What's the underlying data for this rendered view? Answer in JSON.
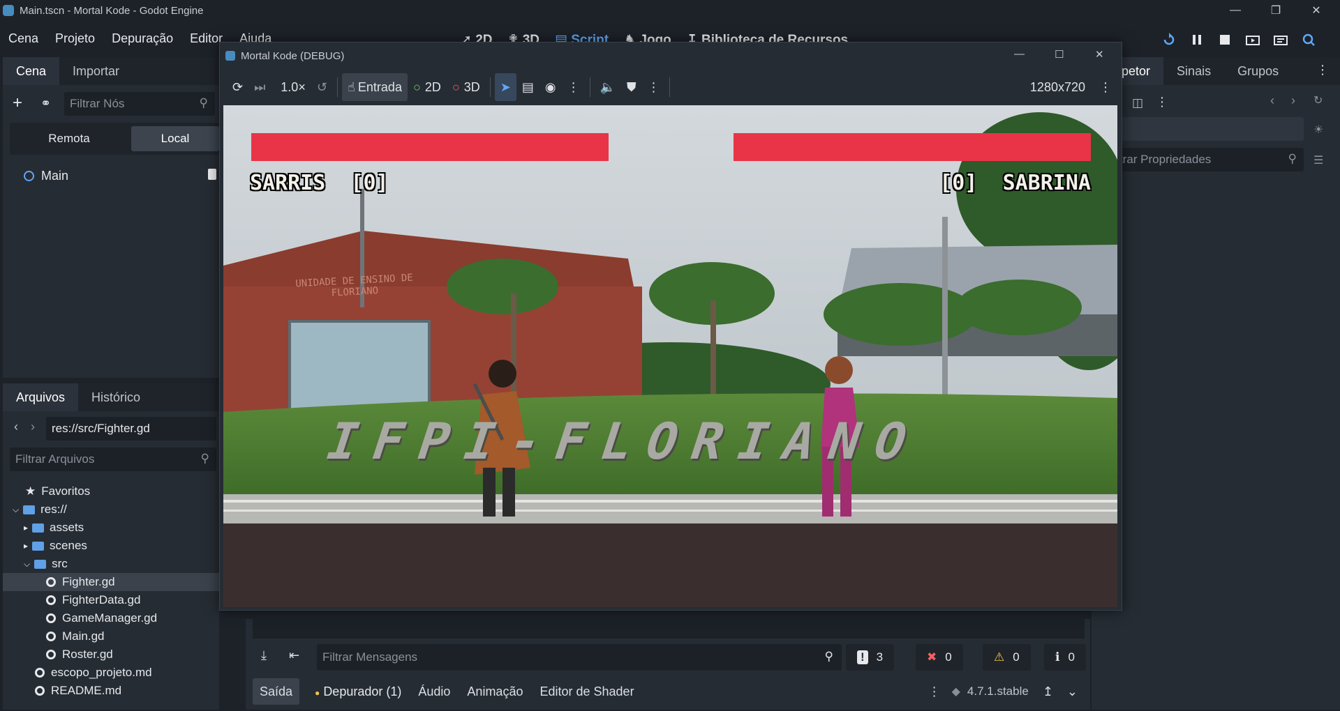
{
  "os": {
    "window_title": "Main.tscn - Mortal Kode - Godot Engine"
  },
  "menu": [
    "Cena",
    "Projeto",
    "Depuração",
    "Editor",
    "Ajuda"
  ],
  "workspaces": [
    "2D",
    "3D",
    "Script",
    "Jogo",
    "Biblioteca de Recursos"
  ],
  "workspace_active": "Script",
  "scene_dock": {
    "tabs": [
      "Cena",
      "Importar"
    ],
    "filter_placeholder": "Filtrar Nós",
    "remote_label": "Remota",
    "local_label": "Local",
    "root_node": "Main"
  },
  "file_dock": {
    "tabs": [
      "Arquivos",
      "Histórico"
    ],
    "path": "res://src/Fighter.gd",
    "filter_placeholder": "Filtrar Arquivos",
    "favorites": "Favoritos",
    "res_root": "res://",
    "items": [
      "assets",
      "scenes",
      "src",
      "Fighter.gd",
      "FighterData.gd",
      "GameManager.gd",
      "Main.gd",
      "Roster.gd",
      "escopo_projeto.md",
      "README.md"
    ]
  },
  "inspector": {
    "tabs": [
      "Inspetor",
      "Sinais",
      "Grupos"
    ],
    "filter_placeholder": "Filtrar Propriedades"
  },
  "bottom": {
    "filter_placeholder": "Filtrar Mensagens",
    "counts": {
      "messages": "3",
      "errors": "0",
      "warnings": "0",
      "info": "0"
    },
    "tabs": [
      "Saída",
      "Depurador (1)",
      "Áudio",
      "Animação",
      "Editor de Shader"
    ],
    "version": "4.7.1.stable"
  },
  "game_window": {
    "title": "Mortal Kode (DEBUG)",
    "speed": "1.0×",
    "input_label": "Entrada",
    "mode_2d": "2D",
    "mode_3d": "3D",
    "resolution": "1280x720"
  },
  "game": {
    "player1_name": "SARRIS",
    "player1_score": "[0]",
    "player2_name": "SABRINA",
    "player2_score": "[0]",
    "player1_health": 1.0,
    "player2_health": 1.0,
    "stage_text": "IFPI-FLORIANO",
    "building_sign": "UNIDADE DE ENSINO DE FLORIANO"
  },
  "colors": {
    "accent": "#5fa8f5",
    "health": "#e83446",
    "bg": "#1d2229",
    "panel": "#262c34"
  }
}
